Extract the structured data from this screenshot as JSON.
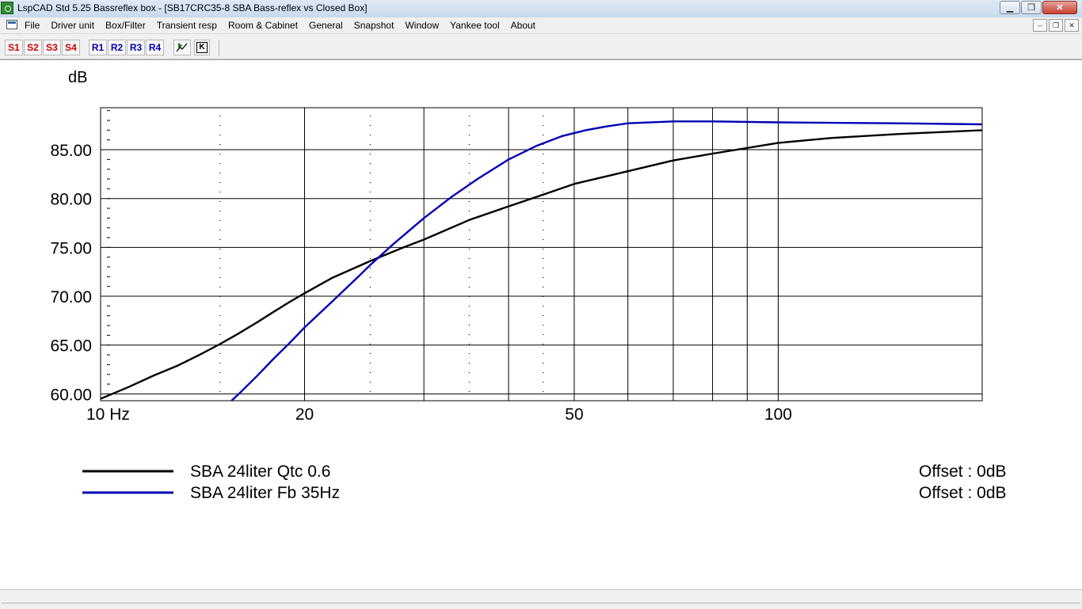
{
  "window": {
    "title": "LspCAD Std 5.25 Bassreflex box - [SB17CRC35-8 SBA Bass-reflex vs Closed Box]",
    "minimize_glyph": "▁",
    "maximize_glyph": "❐",
    "close_glyph": "✕"
  },
  "menu": {
    "items": [
      "File",
      "Driver unit",
      "Box/Filter",
      "Transient resp",
      "Room & Cabinet",
      "General",
      "Snapshot",
      "Window",
      "Yankee tool",
      "About"
    ],
    "mdi_minimize": "–",
    "mdi_restore": "❐",
    "mdi_close": "✕"
  },
  "toolbar": {
    "s_buttons": [
      "S1",
      "S2",
      "S3",
      "S4"
    ],
    "r_buttons": [
      "R1",
      "R2",
      "R3",
      "R4"
    ],
    "icon_names": [
      "plot-cursor-icon",
      "marker-k-icon"
    ],
    "k_label": "K",
    "colors": {
      "s": "#d00000",
      "r": "#0000b0"
    }
  },
  "chart_data": {
    "type": "line",
    "ylabel": "dB",
    "x_scale": "log",
    "x_range": [
      10,
      200
    ],
    "y_range": [
      59.3,
      89.3
    ],
    "x_tick_labels": [
      "10 Hz",
      "20",
      "50",
      "100"
    ],
    "x_ticks": [
      10,
      20,
      50,
      100
    ],
    "x_major_grid": [
      10,
      20,
      30,
      40,
      50,
      60,
      70,
      80,
      90,
      100,
      200
    ],
    "x_dotted_grid": [
      15,
      25,
      35,
      45
    ],
    "y_ticks": [
      60,
      65,
      70,
      75,
      80,
      85
    ],
    "y_tick_labels": [
      "60.00",
      "65.00",
      "70.00",
      "75.00",
      "80.00",
      "85.00"
    ],
    "grid": true,
    "series": [
      {
        "name": "SBA 24liter Qtc 0.6",
        "color": "#000000",
        "offset_text": "Offset : 0dB",
        "points": [
          [
            10,
            59.5
          ],
          [
            11,
            60.7
          ],
          [
            12,
            61.9
          ],
          [
            13,
            62.9
          ],
          [
            14,
            64.0
          ],
          [
            15,
            65.1
          ],
          [
            16,
            66.2
          ],
          [
            17,
            67.3
          ],
          [
            18,
            68.4
          ],
          [
            19,
            69.4
          ],
          [
            20,
            70.3
          ],
          [
            22,
            71.9
          ],
          [
            25,
            73.6
          ],
          [
            28,
            75.0
          ],
          [
            30,
            75.8
          ],
          [
            35,
            77.8
          ],
          [
            40,
            79.2
          ],
          [
            45,
            80.4
          ],
          [
            50,
            81.5
          ],
          [
            60,
            82.8
          ],
          [
            70,
            83.9
          ],
          [
            80,
            84.6
          ],
          [
            100,
            85.7
          ],
          [
            120,
            86.2
          ],
          [
            150,
            86.6
          ],
          [
            200,
            87.0
          ]
        ]
      },
      {
        "name": "SBA 24liter Fb 35Hz",
        "color": "#0000b4",
        "offset_text": "Offset : 0dB",
        "points": [
          [
            15.6,
            59.3
          ],
          [
            16,
            60.0
          ],
          [
            17,
            61.8
          ],
          [
            18,
            63.6
          ],
          [
            19,
            65.2
          ],
          [
            20,
            66.8
          ],
          [
            22,
            69.5
          ],
          [
            24,
            72.0
          ],
          [
            25,
            73.2
          ],
          [
            27,
            75.3
          ],
          [
            30,
            78.0
          ],
          [
            33,
            80.2
          ],
          [
            36,
            82.0
          ],
          [
            40,
            84.0
          ],
          [
            44,
            85.4
          ],
          [
            48,
            86.4
          ],
          [
            52,
            87.0
          ],
          [
            56,
            87.4
          ],
          [
            60,
            87.7
          ],
          [
            70,
            87.9
          ],
          [
            80,
            87.9
          ],
          [
            100,
            87.8
          ],
          [
            150,
            87.7
          ],
          [
            200,
            87.6
          ]
        ]
      }
    ]
  }
}
